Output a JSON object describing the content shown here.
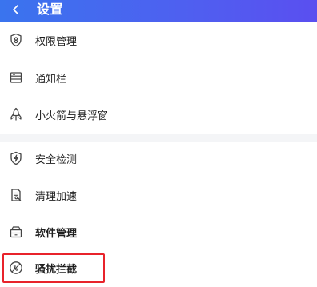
{
  "header": {
    "title": "设置",
    "background": "#4a63ef"
  },
  "group1": {
    "items": [
      {
        "label": "权限管理",
        "icon": "shield-lock-icon"
      },
      {
        "label": "通知栏",
        "icon": "notification-bar-icon"
      },
      {
        "label": "小火箭与悬浮窗",
        "icon": "rocket-icon"
      }
    ]
  },
  "group2": {
    "items": [
      {
        "label": "安全检测",
        "icon": "shield-bolt-icon"
      },
      {
        "label": "清理加速",
        "icon": "cleanup-document-icon"
      },
      {
        "label": "软件管理",
        "icon": "software-box-icon"
      },
      {
        "label": "骚扰拦截",
        "icon": "intercept-phone-icon"
      }
    ]
  },
  "highlight_color": "#e8232b"
}
